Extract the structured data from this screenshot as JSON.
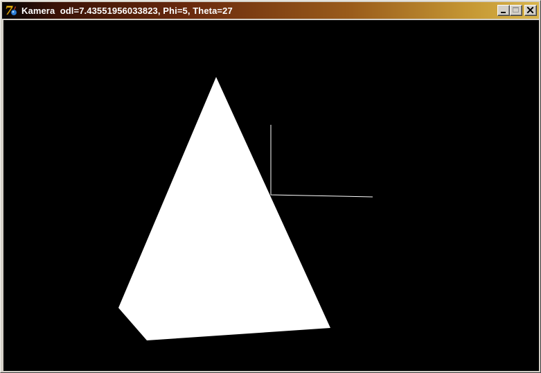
{
  "window": {
    "title": "Kamera  odl=7.43551956033823, Phi=5, Theta=27",
    "app_icon": "delphi-7-icon",
    "buttons": {
      "minimize": "minimize-icon",
      "maximize": "maximize-icon",
      "close": "close-icon"
    }
  },
  "scene": {
    "background_color": "#000000",
    "pyramid_color": "#ffffff",
    "axis_color": "#ffffff"
  }
}
